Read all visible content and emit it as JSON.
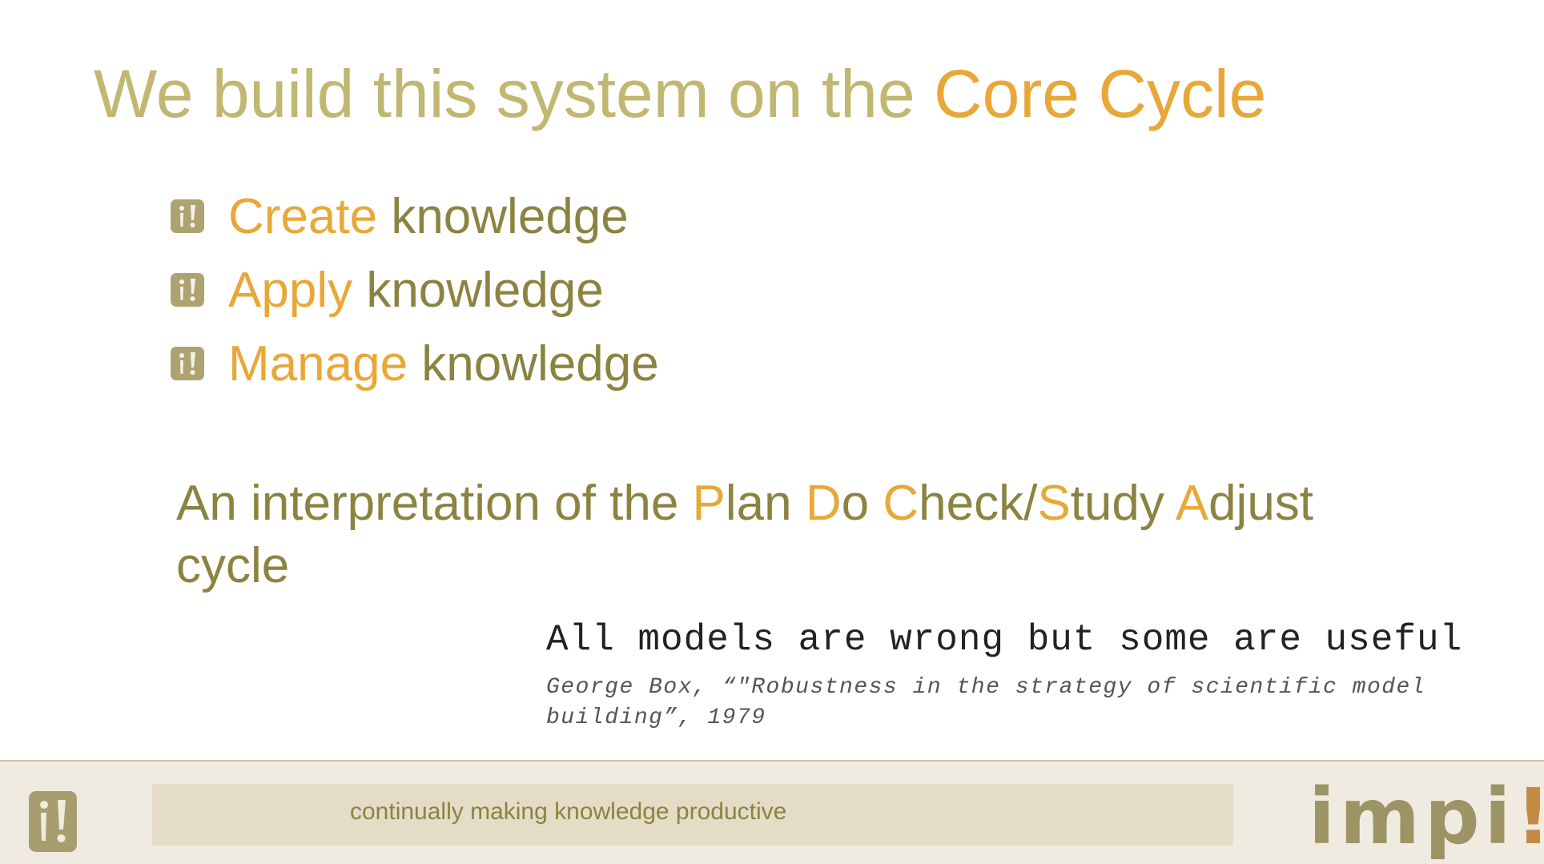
{
  "slide": {
    "title": {
      "prefix": "We build this system on the ",
      "accent": "Core Cycle"
    },
    "bullets": [
      {
        "icon": "impi-bullet-icon",
        "verb": "Create",
        "noun": " knowledge"
      },
      {
        "icon": "impi-bullet-icon",
        "verb": "Apply",
        "noun": " knowledge"
      },
      {
        "icon": "impi-bullet-icon",
        "verb": "Manage",
        "noun": " knowledge"
      }
    ],
    "pdca": {
      "t0": "An interpretation of the ",
      "p": "P",
      "t1": "lan ",
      "d": "D",
      "t2": "o ",
      "c": "C",
      "t3": "heck/",
      "s": "S",
      "t4": "tudy ",
      "a": "A",
      "t5": "djust cycle"
    },
    "quote": "All models are wrong but some are useful",
    "citation": "George Box, “\"Robustness in the strategy of scientific model building”, 1979"
  },
  "footer": {
    "tagline": "continually making knowledge productive",
    "brand": {
      "name": "impi",
      "bang": "!"
    },
    "logo_icon": "impi-logo-icon"
  },
  "colors": {
    "title": "#c1b771",
    "accent": "#e8a838",
    "olive": "#8b8340",
    "footer_bg": "#efebe1",
    "tagline_bg": "#e5dcc8",
    "brand": "#9c9465",
    "brand_bang": "#c48a44"
  }
}
